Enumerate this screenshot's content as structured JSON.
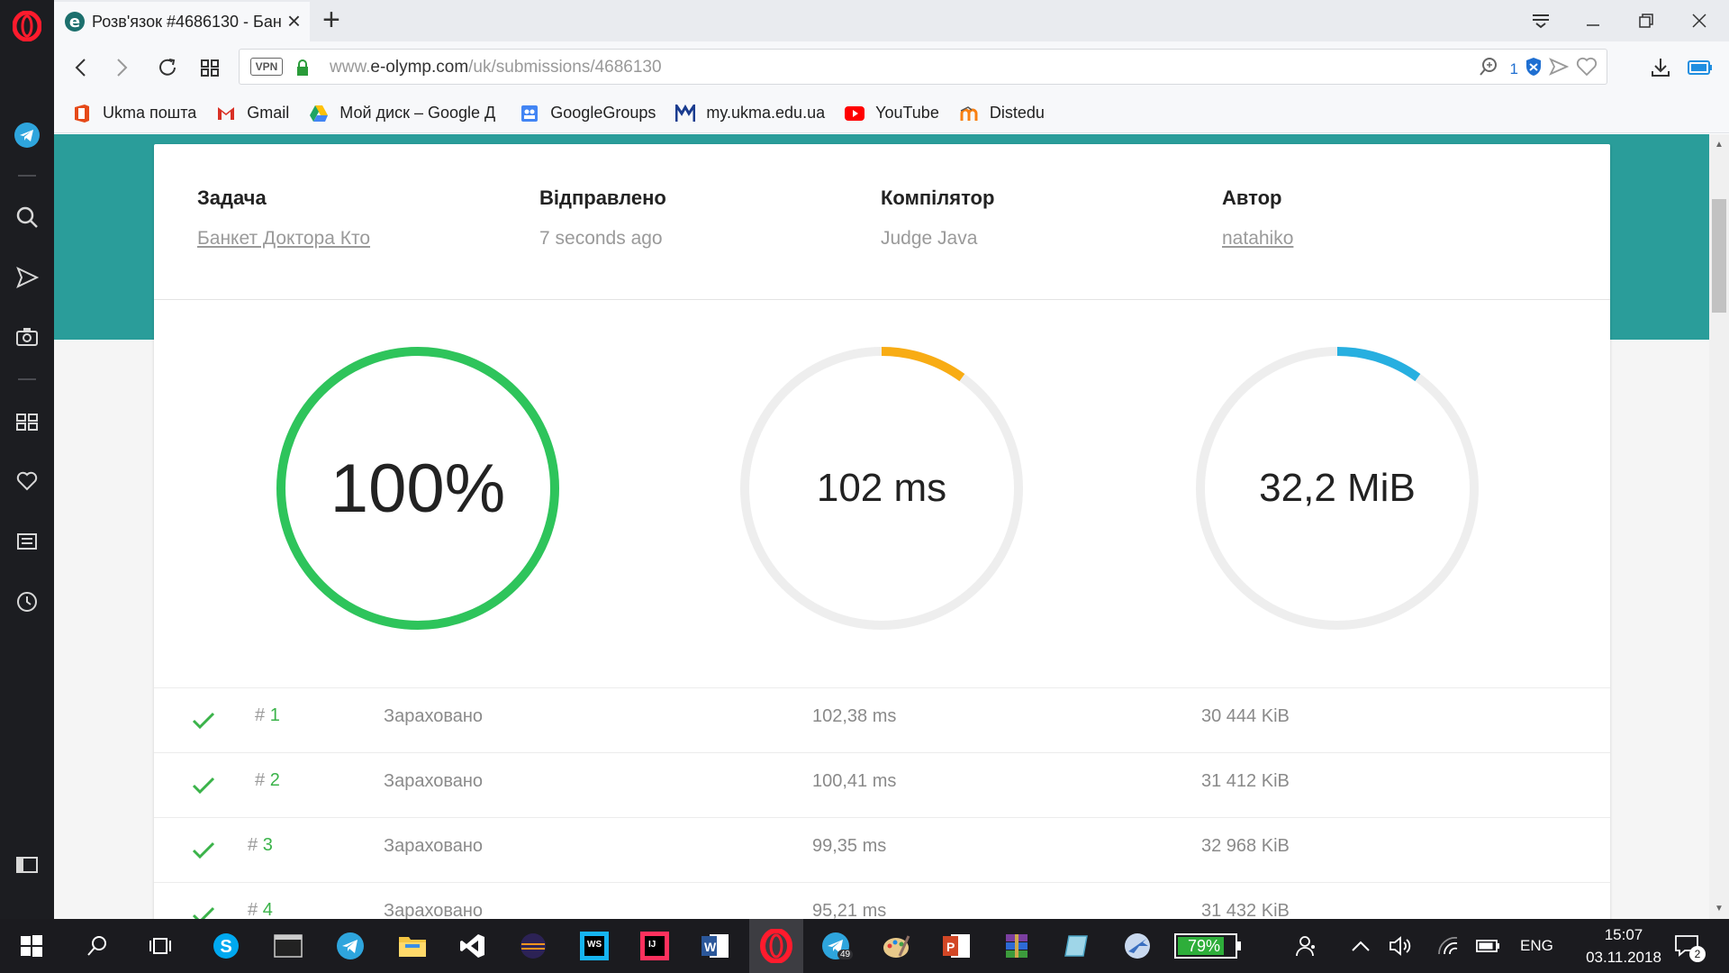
{
  "browser": {
    "tab_title": "Розв'язок #4686130 - Бан",
    "url_prefix": "www.",
    "url_host": "e-olymp.com",
    "url_path": "/uk/submissions/4686130",
    "vpn_label": "VPN",
    "adblock_count": "1"
  },
  "bookmarks": [
    {
      "label": "Ukma пошта",
      "icon": "office-icon",
      "color": "#e64a19"
    },
    {
      "label": "Gmail",
      "icon": "gmail-icon",
      "color": "#d93025"
    },
    {
      "label": "Мой диск – Google Д",
      "icon": "drive-icon",
      "color": "#1fa463"
    },
    {
      "label": "GoogleGroups",
      "icon": "groups-icon",
      "color": "#4285f4"
    },
    {
      "label": "my.ukma.edu.ua",
      "icon": "ukma-icon",
      "color": "#1a3c8f"
    },
    {
      "label": "YouTube",
      "icon": "youtube-icon",
      "color": "#ff0000"
    },
    {
      "label": "Distedu",
      "icon": "moodle-icon",
      "color": "#f98012"
    }
  ],
  "submission": {
    "task_label": "Задача",
    "task_value": "Банкет Доктора Кто",
    "sent_label": "Відправлено",
    "sent_value": "7 seconds ago",
    "compiler_label": "Компілятор",
    "compiler_value": "Judge Java",
    "author_label": "Автор",
    "author_value": "natahiko"
  },
  "gauges": [
    {
      "text": "100%",
      "fraction": 1.0,
      "color": "#2ec45b"
    },
    {
      "text": "102 ms",
      "fraction": 0.1,
      "color": "#f8ac14"
    },
    {
      "text": "32,2 MiB",
      "fraction": 0.1,
      "color": "#27afe0"
    }
  ],
  "results": [
    {
      "hash": "# ",
      "num": "1",
      "status": "Зараховано",
      "time": "102,38 ms",
      "mem": "30 444 KiB"
    },
    {
      "hash": "# ",
      "num": "2",
      "status": "Зараховано",
      "time": "100,41 ms",
      "mem": "31 412 KiB"
    },
    {
      "hash": "# ",
      "num": "3",
      "status": "Зараховано",
      "time": "99,35 ms",
      "mem": "32 968 KiB"
    },
    {
      "hash": "# ",
      "num": "4",
      "status": "Зараховано",
      "time": "95,21 ms",
      "mem": "31 432 KiB"
    }
  ],
  "taskbar": {
    "battery_percent": "79%",
    "language": "ENG",
    "time": "15:07",
    "date": "03.11.2018",
    "telegram_badge": "49",
    "notification_count": "2"
  },
  "colors": {
    "teal": "#2a9d9a",
    "check_green": "#3bb34a"
  }
}
